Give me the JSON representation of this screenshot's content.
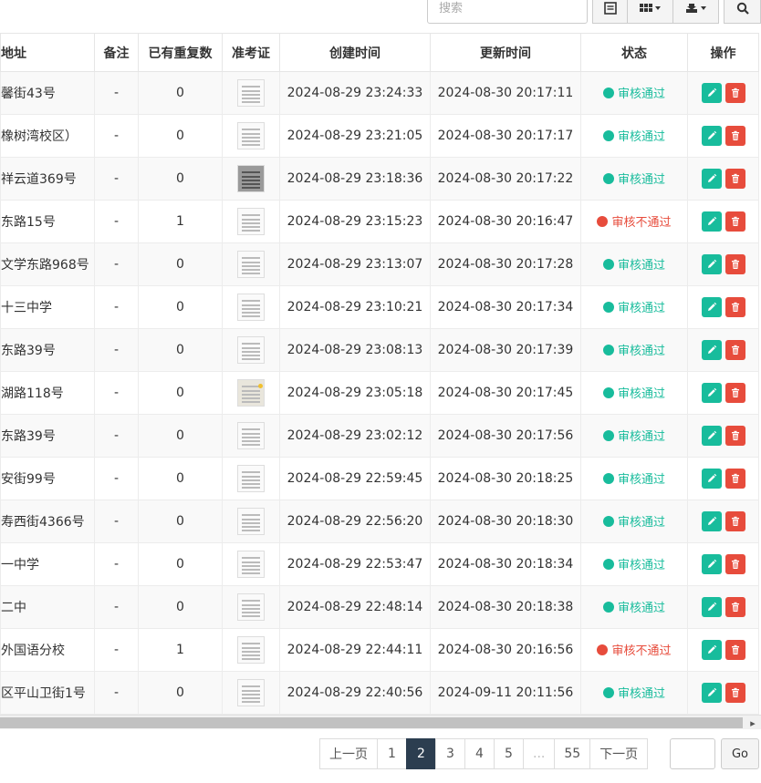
{
  "toolbar": {
    "search_placeholder": "搜索"
  },
  "columns": {
    "address": "地址",
    "remark": "备注",
    "duplicates": "已有重复数",
    "admission_ticket": "准考证",
    "created": "创建时间",
    "updated": "更新时间",
    "status": "状态",
    "actions": "操作"
  },
  "rows": [
    {
      "address": "馨街43号",
      "remark": "-",
      "dup": "0",
      "thumb": "doc",
      "created": "2024-08-29 23:24:33",
      "updated": "2024-08-30 20:17:11",
      "status": "审核通过",
      "status_kind": "ok"
    },
    {
      "address": "橡树湾校区）",
      "remark": "-",
      "dup": "0",
      "thumb": "doc",
      "created": "2024-08-29 23:21:05",
      "updated": "2024-08-30 20:17:17",
      "status": "审核通过",
      "status_kind": "ok"
    },
    {
      "address": "祥云道369号",
      "remark": "-",
      "dup": "0",
      "thumb": "dark",
      "created": "2024-08-29 23:18:36",
      "updated": "2024-08-30 20:17:22",
      "status": "审核通过",
      "status_kind": "ok"
    },
    {
      "address": "东路15号",
      "remark": "-",
      "dup": "1",
      "thumb": "doc",
      "created": "2024-08-29 23:15:23",
      "updated": "2024-08-30 20:16:47",
      "status": "审核不通过",
      "status_kind": "bad"
    },
    {
      "address": "文学东路968号",
      "remark": "-",
      "dup": "0",
      "thumb": "doc",
      "created": "2024-08-29 23:13:07",
      "updated": "2024-08-30 20:17:28",
      "status": "审核通过",
      "status_kind": "ok"
    },
    {
      "address": "十三中学",
      "remark": "-",
      "dup": "0",
      "thumb": "doc",
      "created": "2024-08-29 23:10:21",
      "updated": "2024-08-30 20:17:34",
      "status": "审核通过",
      "status_kind": "ok"
    },
    {
      "address": "东路39号",
      "remark": "-",
      "dup": "0",
      "thumb": "doc",
      "created": "2024-08-29 23:08:13",
      "updated": "2024-08-30 20:17:39",
      "status": "审核通过",
      "status_kind": "ok"
    },
    {
      "address": "湖路118号",
      "remark": "-",
      "dup": "0",
      "thumb": "yellow",
      "created": "2024-08-29 23:05:18",
      "updated": "2024-08-30 20:17:45",
      "status": "审核通过",
      "status_kind": "ok"
    },
    {
      "address": "东路39号",
      "remark": "-",
      "dup": "0",
      "thumb": "doc",
      "created": "2024-08-29 23:02:12",
      "updated": "2024-08-30 20:17:56",
      "status": "审核通过",
      "status_kind": "ok"
    },
    {
      "address": "安街99号",
      "remark": "-",
      "dup": "0",
      "thumb": "doc",
      "created": "2024-08-29 22:59:45",
      "updated": "2024-08-30 20:18:25",
      "status": "审核通过",
      "status_kind": "ok"
    },
    {
      "address": "寿西街4366号",
      "remark": "-",
      "dup": "0",
      "thumb": "doc",
      "created": "2024-08-29 22:56:20",
      "updated": "2024-08-30 20:18:30",
      "status": "审核通过",
      "status_kind": "ok"
    },
    {
      "address": "一中学",
      "remark": "-",
      "dup": "0",
      "thumb": "doc",
      "created": "2024-08-29 22:53:47",
      "updated": "2024-08-30 20:18:34",
      "status": "审核通过",
      "status_kind": "ok"
    },
    {
      "address": "二中",
      "remark": "-",
      "dup": "0",
      "thumb": "doc",
      "created": "2024-08-29 22:48:14",
      "updated": "2024-08-30 20:18:38",
      "status": "审核通过",
      "status_kind": "ok"
    },
    {
      "address": "外国语分校",
      "remark": "-",
      "dup": "1",
      "thumb": "doc",
      "created": "2024-08-29 22:44:11",
      "updated": "2024-08-30 20:16:56",
      "status": "审核不通过",
      "status_kind": "bad"
    },
    {
      "address": "区平山卫街1号",
      "remark": "-",
      "dup": "0",
      "thumb": "doc",
      "created": "2024-08-29 22:40:56",
      "updated": "2024-09-11 20:11:56",
      "status": "审核通过",
      "status_kind": "ok"
    }
  ],
  "pagination": {
    "prev": "上一页",
    "pages": [
      "1",
      "2",
      "3",
      "4",
      "5",
      "...",
      "55"
    ],
    "current": "2",
    "next": "下一页",
    "go": "Go"
  },
  "colors": {
    "ok": "#18bc9c",
    "bad": "#e74c3c",
    "active_page": "#2c3e50"
  }
}
